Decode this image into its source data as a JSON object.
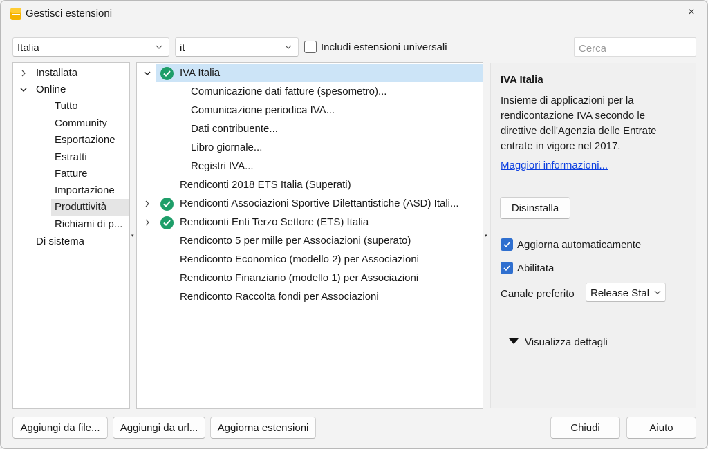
{
  "window": {
    "title": "Gestisci estensioni",
    "close_label": "×"
  },
  "filters": {
    "country": "Italia",
    "language": "it",
    "include_universal_label": "Includi estensioni universali",
    "include_universal_checked": false,
    "search_placeholder": "Cerca"
  },
  "nav": {
    "items": [
      {
        "label": "Installata",
        "level": 0,
        "expanded": false,
        "has_children": true
      },
      {
        "label": "Online",
        "level": 0,
        "expanded": true,
        "has_children": true
      },
      {
        "label": "Tutto",
        "level": 1
      },
      {
        "label": "Community",
        "level": 1
      },
      {
        "label": "Esportazione",
        "level": 1
      },
      {
        "label": "Estratti",
        "level": 1
      },
      {
        "label": "Fatture",
        "level": 1
      },
      {
        "label": "Importazione",
        "level": 1
      },
      {
        "label": "Produttività",
        "level": 1,
        "selected": true
      },
      {
        "label": "Richiami di p...",
        "level": 1
      },
      {
        "label": "Di sistema",
        "level": 0
      }
    ]
  },
  "extensions": {
    "rows": [
      {
        "label": "IVA Italia",
        "installed": true,
        "expanded": true,
        "selected": true
      },
      {
        "label": "Comunicazione dati fatture (spesometro)...",
        "child": true
      },
      {
        "label": "Comunicazione periodica IVA...",
        "child": true
      },
      {
        "label": "Dati contribuente...",
        "child": true
      },
      {
        "label": "Libro giornale...",
        "child": true
      },
      {
        "label": "Registri IVA...",
        "child": true
      },
      {
        "label": "Rendiconti 2018 ETS Italia (Superati)"
      },
      {
        "label": "Rendiconti Associazioni Sportive Dilettantistiche (ASD) Itali...",
        "installed": true,
        "collapsed": true
      },
      {
        "label": "Rendiconti Enti Terzo Settore (ETS) Italia",
        "installed": true,
        "collapsed": true
      },
      {
        "label": "Rendiconto 5 per mille per Associazioni (superato)"
      },
      {
        "label": "Rendiconto Economico (modello 2) per Associazioni"
      },
      {
        "label": "Rendiconto Finanziario (modello 1) per Associazioni"
      },
      {
        "label": "Rendiconto Raccolta fondi per Associazioni"
      }
    ]
  },
  "detail": {
    "title": "IVA Italia",
    "description": "Insieme di applicazioni per la rendicontazione IVA secondo le direttive dell'Agenzia delle Entrate entrate in vigore nel 2017.",
    "more_info_link": "Maggiori informazioni...",
    "uninstall_button": "Disinstalla",
    "auto_update_label": "Aggiorna automaticamente",
    "auto_update_checked": true,
    "enabled_label": "Abilitata",
    "enabled_checked": true,
    "channel_label": "Canale preferito",
    "channel_value": "Release Stal",
    "show_details_label": "Visualizza dettagli"
  },
  "footer": {
    "add_from_file": "Aggiungi da file...",
    "add_from_url": "Aggiungi da url...",
    "update_extensions": "Aggiorna estensioni",
    "close": "Chiudi",
    "help": "Aiuto"
  },
  "colors": {
    "accent": "#2f6fcf",
    "installed_badge": "#1e9e69",
    "selection": "#cce4f7",
    "link": "#0b3ee0"
  }
}
